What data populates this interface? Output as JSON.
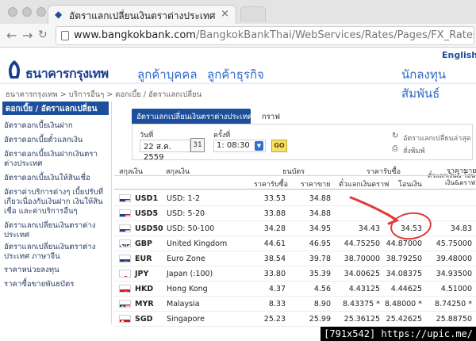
{
  "browser": {
    "tab_title": "อัตราแลกเปลี่ยนเงินตราต่างประเทศ",
    "url_host": "www.bangkokbank.com",
    "url_path": "/BangkokBankThai/WebServices/Rates/Pages/FX_Rates.aspx"
  },
  "header": {
    "english_link": "English",
    "logo_text": "ธนาคารกรุงเทพ",
    "nav": [
      "ลูกค้าบุคคล",
      "ลูกค้าธุรกิจ",
      "นักลงทุนสัมพันธ์"
    ]
  },
  "breadcrumb": "ธนาคารกรุงเทพ > บริการอื่นๆ > ดอกเบี้ย / อัตราแลกเปลี่ยน",
  "sidebar": {
    "heading": "ดอกเบี้ย / อัตราแลกเปลี่ยน",
    "items": [
      "อัตราดอกเบี้ยเงินฝาก",
      "อัตราดอกเบี้ยตั๋วแลกเงิน",
      "อัตราดอกเบี้ยเงินฝากเงินตราต่างประเทศ",
      "อัตราดอกเบี้ยเงินให้สินเชื่อ",
      "อัตราค่าบริการต่างๆ เบี้ยปรับที่เกี่ยวเนื่องกับเงินฝาก เงินให้สินเชื่อ และค่าบริการอื่นๆ",
      "อัตราแลกเปลี่ยนเงินตราต่างประเทศ",
      "อัตราแลกเปลี่ยนเงินตราต่างประเทศ ภาษาจีน",
      "ราคาหน่วยลงทุน",
      "ราคาซื้อขายพันธบัตร"
    ]
  },
  "panel": {
    "tab_active": "อัตราแลกเปลี่ยนเงินตราต่างประเทศ",
    "tab_other": "กราฟ",
    "date_label": "วันที่",
    "date_value": "22 ส.ค. 2559",
    "calendar_label": "31",
    "time_label": "ครั้งที่",
    "time_value": "1: 08:30",
    "go_label": "GO",
    "latest_link": "อัตราแลกเปลี่ยนล่าสุด",
    "print_link": "สั่งพิมพ์"
  },
  "table": {
    "headers": {
      "currency": "สกุลเงิน",
      "currency_name": "สกุลเงิน",
      "banknote": "ธนบัตร",
      "buying_rate": "ราคารับซื้อ",
      "selling_rate_top": "ราคาขาย",
      "buy": "ราคารับซื้อ",
      "sell": "ราคาขาย",
      "draft": "ตั๋วแลกเงินดราฟ",
      "transfer": "โอนเงิน",
      "selling_sub": "ตั๋วแลกเงิน& โอนเงิน&ดราฟ"
    },
    "rows": [
      {
        "code": "USD1",
        "desc": "USD: 1-2",
        "buy": "33.53",
        "sell": "34.88",
        "draft": "",
        "transfer": "",
        "selling": "",
        "flag": "us"
      },
      {
        "code": "USD5",
        "desc": "USD: 5-20",
        "buy": "33.88",
        "sell": "34.88",
        "draft": "",
        "transfer": "",
        "selling": "",
        "flag": "us"
      },
      {
        "code": "USD50",
        "desc": "USD: 50-100",
        "buy": "34.28",
        "sell": "34.95",
        "draft": "34.43",
        "transfer": "34.53",
        "selling": "34.83",
        "flag": "us"
      },
      {
        "code": "GBP",
        "desc": "United Kingdom",
        "buy": "44.61",
        "sell": "46.95",
        "draft": "44.75250",
        "transfer": "44.87000",
        "selling": "45.75000",
        "flag": "gb"
      },
      {
        "code": "EUR",
        "desc": "Euro Zone",
        "buy": "38.54",
        "sell": "39.78",
        "draft": "38.70000",
        "transfer": "38.79250",
        "selling": "39.48000",
        "flag": "eu"
      },
      {
        "code": "JPY",
        "desc": "Japan (:100)",
        "buy": "33.80",
        "sell": "35.39",
        "draft": "34.00625",
        "transfer": "34.08375",
        "selling": "34.93500",
        "flag": "jp"
      },
      {
        "code": "HKD",
        "desc": "Hong Kong",
        "buy": "4.37",
        "sell": "4.56",
        "draft": "4.43125",
        "transfer": "4.44625",
        "selling": "4.51000",
        "flag": "hk"
      },
      {
        "code": "MYR",
        "desc": "Malaysia",
        "buy": "8.33",
        "sell": "8.90",
        "draft": "8.43375 *",
        "transfer": "8.48000 *",
        "selling": "8.74250 *",
        "flag": "my"
      },
      {
        "code": "SGD",
        "desc": "Singapore",
        "buy": "25.23",
        "sell": "25.99",
        "draft": "25.36125",
        "transfer": "25.42625",
        "selling": "25.88750",
        "flag": "sg"
      }
    ]
  },
  "watermark": "[791x542] https://upic.me/",
  "colors": {
    "brand": "#1c4f9c",
    "accent": "#2f69c8",
    "highlight": "#e03a3a"
  }
}
